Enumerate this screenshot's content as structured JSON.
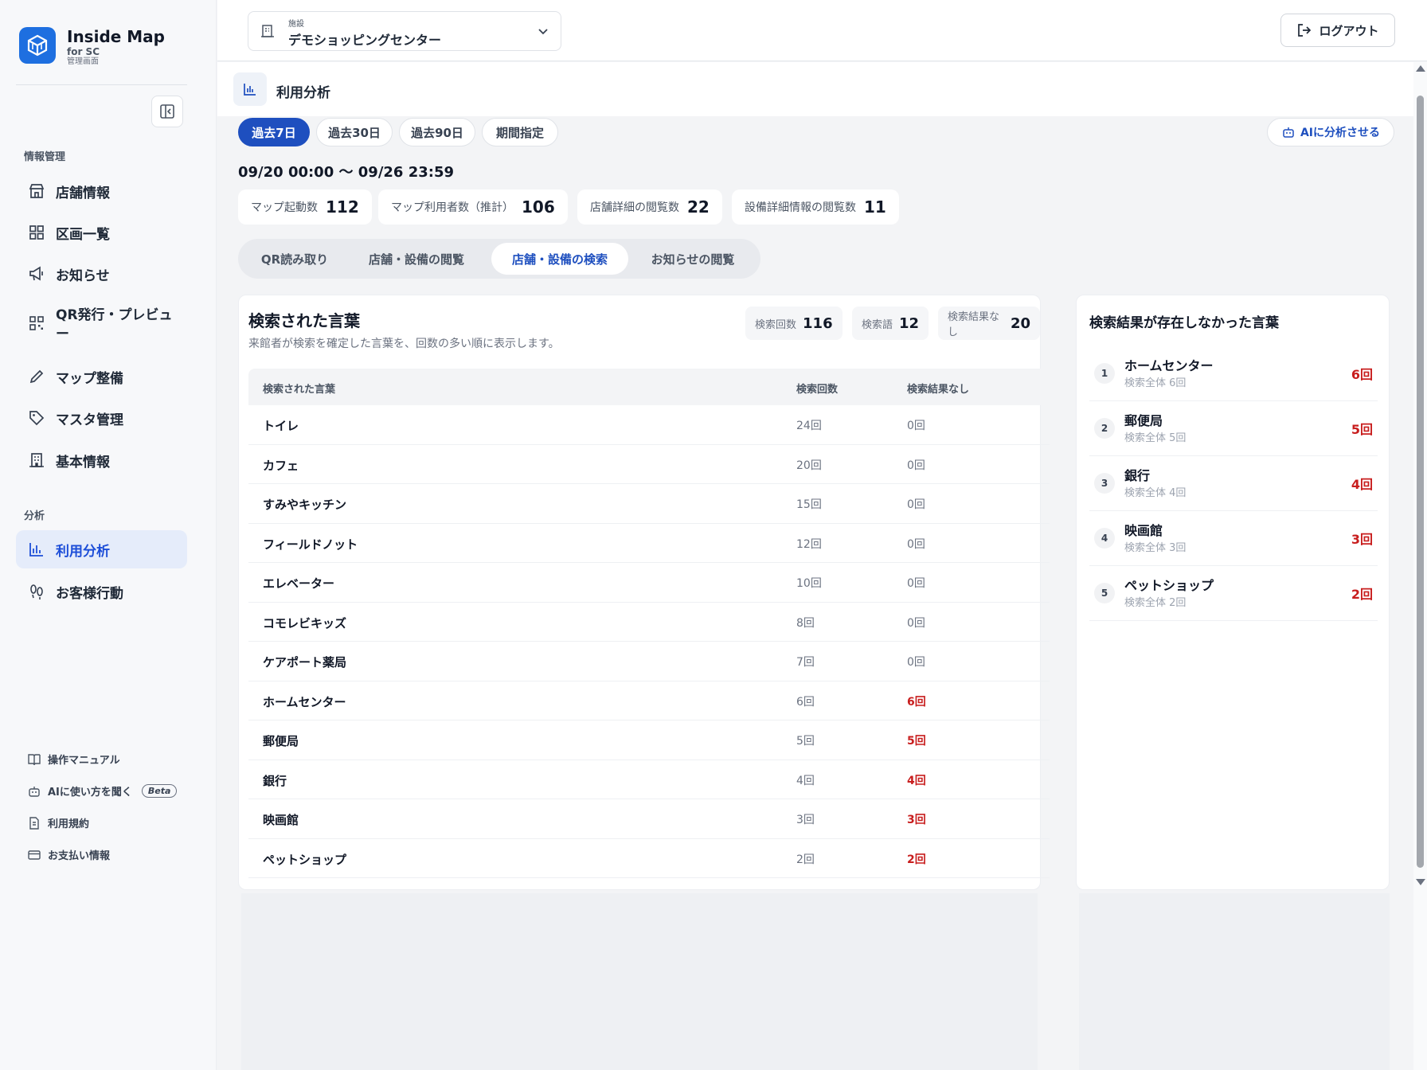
{
  "brand": {
    "name": "Inside Map",
    "sub": "for SC",
    "caption": "管理画面"
  },
  "sidebar": {
    "section_info": "情報管理",
    "section_analysis": "分析",
    "items": [
      {
        "label": "店舗情報",
        "icon": "store-icon"
      },
      {
        "label": "区画一覧",
        "icon": "grid-icon"
      },
      {
        "label": "お知らせ",
        "icon": "megaphone-icon"
      },
      {
        "label": "QR発行・プレビュー",
        "icon": "qr-icon"
      },
      {
        "label": "マップ整備",
        "icon": "pencil-icon"
      },
      {
        "label": "マスタ管理",
        "icon": "tag-icon"
      },
      {
        "label": "基本情報",
        "icon": "building-icon"
      },
      {
        "label": "利用分析",
        "icon": "bar-chart-icon",
        "active": true
      },
      {
        "label": "お客様行動",
        "icon": "footprints-icon"
      }
    ],
    "footer": [
      {
        "label": "操作マニュアル",
        "icon": "book-icon"
      },
      {
        "label": "AIに使い方を聞く",
        "icon": "robot-icon",
        "badge": "Beta"
      },
      {
        "label": "利用規約",
        "icon": "document-icon"
      },
      {
        "label": "お支払い情報",
        "icon": "credit-card-icon"
      }
    ]
  },
  "header": {
    "facility_label": "施設",
    "facility_value": "デモショッピングセンター",
    "logout_label": "ログアウト"
  },
  "page": {
    "title": "利用分析"
  },
  "period": {
    "options": [
      "過去7日",
      "過去30日",
      "過去90日",
      "期間指定"
    ],
    "selected": "過去7日",
    "range": "09/20 00:00 〜 09/26 23:59",
    "ai_button": "AIに分析させる"
  },
  "kpis": [
    {
      "label": "マップ起動数",
      "value": "112"
    },
    {
      "label": "マップ利用者数（推計）",
      "value": "106"
    },
    {
      "label": "店舗詳細の閲覧数",
      "value": "22"
    },
    {
      "label": "設備詳細情報の閲覧数",
      "value": "11"
    }
  ],
  "tabs": [
    "QR読み取り",
    "店舗・設備の閲覧",
    "店舗・設備の検索",
    "お知らせの閲覧"
  ],
  "active_tab": "店舗・設備の検索",
  "search_card": {
    "title": "検索された言葉",
    "description": "来館者が検索を確定した言葉を、回数の多い順に表示します。",
    "stats": [
      {
        "label": "検索回数",
        "value": "116"
      },
      {
        "label": "検索語",
        "value": "12"
      },
      {
        "label": "検索結果なし",
        "value": "20"
      }
    ],
    "columns": [
      "検索された言葉",
      "検索回数",
      "検索結果なし"
    ],
    "rows": [
      {
        "term": "トイレ",
        "count": "24回",
        "none": "0回"
      },
      {
        "term": "カフェ",
        "count": "20回",
        "none": "0回"
      },
      {
        "term": "すみやキッチン",
        "count": "15回",
        "none": "0回"
      },
      {
        "term": "フィールドノット",
        "count": "12回",
        "none": "0回"
      },
      {
        "term": "エレベーター",
        "count": "10回",
        "none": "0回"
      },
      {
        "term": "コモレビキッズ",
        "count": "8回",
        "none": "0回"
      },
      {
        "term": "ケアポート薬局",
        "count": "7回",
        "none": "0回"
      },
      {
        "term": "ホームセンター",
        "count": "6回",
        "none": "6回"
      },
      {
        "term": "郵便局",
        "count": "5回",
        "none": "5回"
      },
      {
        "term": "銀行",
        "count": "4回",
        "none": "4回"
      },
      {
        "term": "映画館",
        "count": "3回",
        "none": "3回"
      },
      {
        "term": "ペットショップ",
        "count": "2回",
        "none": "2回"
      }
    ]
  },
  "no_result_card": {
    "title": "検索結果が存在しなかった言葉",
    "items": [
      {
        "rank": "1",
        "term": "ホームセンター",
        "sub": "検索全体 6回",
        "count": "6回"
      },
      {
        "rank": "2",
        "term": "郵便局",
        "sub": "検索全体 5回",
        "count": "5回"
      },
      {
        "rank": "3",
        "term": "銀行",
        "sub": "検索全体 4回",
        "count": "4回"
      },
      {
        "rank": "4",
        "term": "映画館",
        "sub": "検索全体 3回",
        "count": "3回"
      },
      {
        "rank": "5",
        "term": "ペットショップ",
        "sub": "検索全体 2回",
        "count": "2回"
      }
    ]
  },
  "colors": {
    "accent": "#1e4fbf",
    "danger": "#c81e1e",
    "brand": "#1e6fe0"
  }
}
